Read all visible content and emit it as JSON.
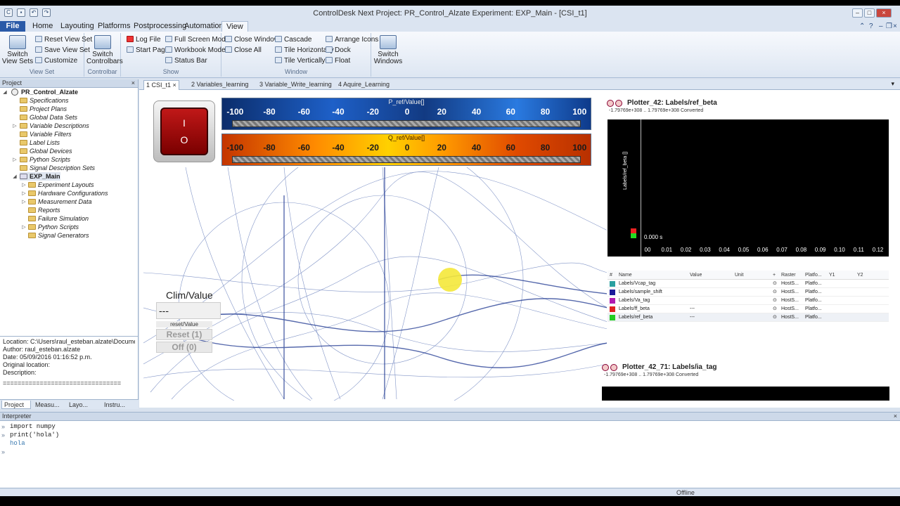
{
  "window": {
    "title": "ControlDesk Next Project: PR_Control_Alzate Experiment: EXP_Main - [CSI_t1]"
  },
  "ribbon_tabs": [
    "File",
    "Home",
    "Layouting",
    "Platforms",
    "Postprocessing",
    "Automation",
    "View"
  ],
  "ribbon": {
    "view_sets": {
      "switch": "Switch View Sets",
      "reset": "Reset View Set",
      "save": "Save View Set",
      "customize": "Customize",
      "label": "View Set"
    },
    "controlbar": {
      "switch": "Switch Controlbars",
      "label": "Controlbar"
    },
    "show": {
      "log_file": "Log File",
      "start_page": "Start Page",
      "full_screen": "Full Screen Mode",
      "workbook": "Workbook Mode",
      "status_bar": "Status Bar",
      "label": "Show"
    },
    "window": {
      "close_window": "Close Window",
      "close_all": "Close All",
      "cascade": "Cascade",
      "tile_h": "Tile Horizontally",
      "tile_v": "Tile Vertically",
      "arrange": "Arrange Icons",
      "dock": "Dock",
      "float": "Float",
      "label": "Window"
    },
    "switch_windows": "Switch Windows"
  },
  "project_pane": {
    "header": "Project",
    "root": "PR_Control_Alzate",
    "items": [
      "Specifications",
      "Project Plans",
      "Global Data Sets",
      "Variable Descriptions",
      "Variable Filters",
      "Label Lists",
      "Global Devices",
      "Python Scripts",
      "Signal Description Sets"
    ],
    "experiment": "EXP_Main",
    "exp_items": [
      "Experiment Layouts",
      "Hardware Configurations",
      "Measurement Data",
      "Reports",
      "Failure Simulation",
      "Python Scripts",
      "Signal Generators"
    ]
  },
  "properties": {
    "location": "Location: C:\\Users\\raul_esteban.alzate\\Documents\\c",
    "author": "Author: raul_esteban.alzate",
    "date": "Date: 05/09/2016 01:16:52 p.m.",
    "original": "Original location:",
    "description": "Description:",
    "separator": "================================"
  },
  "left_tabs": [
    "Project",
    "Measu...",
    "Layo...",
    "Instru..."
  ],
  "doc_tabs": [
    "1 CSI_t1",
    "2 Variables_learning",
    "3 Variable_Write_learning",
    "4 Aquire_Learning"
  ],
  "switch_button": {
    "on": "I",
    "off": "O"
  },
  "gauges": [
    {
      "title": "P_ref/Value[]",
      "ticks": [
        "-100",
        "-80",
        "-60",
        "-40",
        "-20",
        "0",
        "20",
        "40",
        "60",
        "80",
        "100"
      ]
    },
    {
      "title": "Q_ref/Value[]",
      "ticks": [
        "-100",
        "-80",
        "-60",
        "-40",
        "-20",
        "0",
        "20",
        "40",
        "60",
        "80",
        "100"
      ]
    }
  ],
  "clim": {
    "label": "Clim/Value",
    "value": "---",
    "reset_label": "reset/Value",
    "reset_btn": "Reset (1)",
    "off_btn": "Off (0)"
  },
  "plotter1": {
    "title": "Plotter_42:  Labels/ref_beta",
    "range": "-1.79769e+308 .. 1.79769e+308  Converted",
    "ylabel": "Labels/ref_beta []",
    "time": "0.000 s",
    "xticks": [
      "00",
      "0.01",
      "0.02",
      "0.03",
      "0.04",
      "0.05",
      "0.06",
      "0.07",
      "0.08",
      "0.09",
      "0.10",
      "0.11",
      "0.12"
    ]
  },
  "signal_table": {
    "headers": [
      "#",
      "Name",
      "Value",
      "Unit",
      "+",
      "Raster",
      "Platfo...",
      "Y1",
      "Y2"
    ],
    "rows": [
      {
        "name": "Labels/Vcap_tag",
        "value": "",
        "raster": "HostS...",
        "platform": "Platfo...",
        "color": "#2aa0a0"
      },
      {
        "name": "Labels/sample_shift",
        "value": "",
        "raster": "HostS...",
        "platform": "Platfo...",
        "color": "#1a1a9a"
      },
      {
        "name": "Labels/Va_tag",
        "value": "",
        "raster": "HostS...",
        "platform": "Platfo...",
        "color": "#b01ab0"
      },
      {
        "name": "Labels/ff_beta",
        "value": "---",
        "raster": "HostS...",
        "platform": "Platfo...",
        "color": "#e02020"
      },
      {
        "name": "Labels/ref_beta",
        "value": "---",
        "raster": "HostS...",
        "platform": "Platfo...",
        "color": "#22cc22"
      }
    ]
  },
  "plotter2": {
    "title": "Plotter_42_71:  Labels/ia_tag",
    "range": "-1.79769e+308 .. 1.79769e+308  Converted"
  },
  "interpreter": {
    "header": "Interpreter",
    "lines": [
      "import numpy",
      "print('hola')",
      "hola"
    ]
  },
  "status": {
    "text": "Offline"
  }
}
